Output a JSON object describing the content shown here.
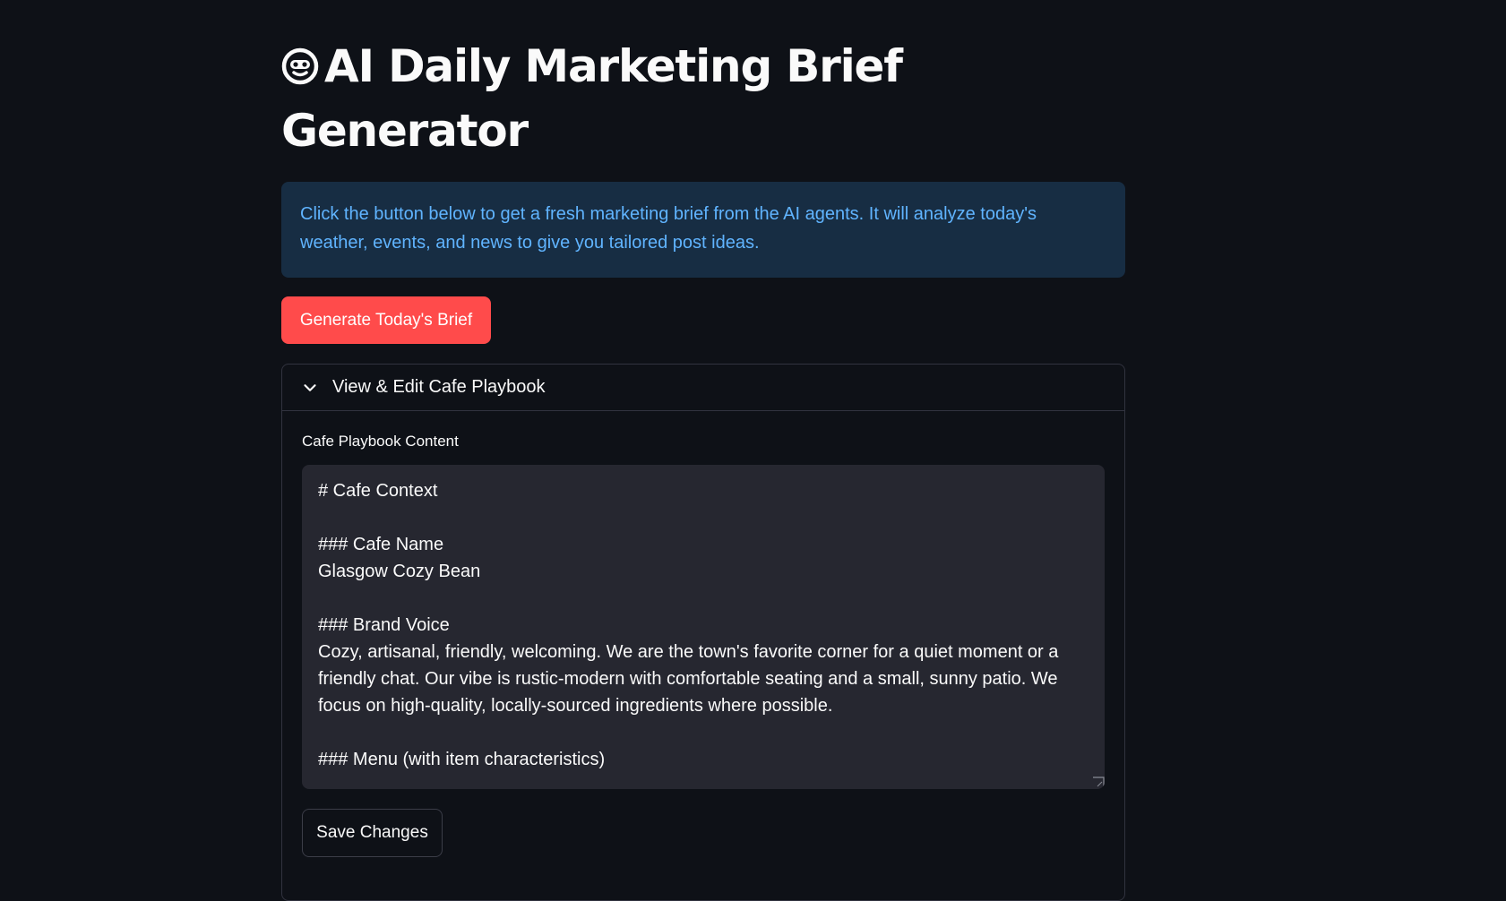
{
  "header": {
    "title": "AI Daily Marketing Brief Generator",
    "title_icon": "robot-face-icon"
  },
  "info": {
    "text": "Click the button below to get a fresh marketing brief from the AI agents. It will analyze today's weather, events, and news to give you tailored post ideas."
  },
  "actions": {
    "generate_label": "Generate Today's Brief"
  },
  "expander": {
    "label": "View & Edit Cafe Playbook",
    "icon": "chevron-down-icon",
    "field_label": "Cafe Playbook Content",
    "content": "# Cafe Context\n\n### Cafe Name\nGlasgow Cozy Bean\n\n### Brand Voice\nCozy, artisanal, friendly, welcoming. We are the town's favorite corner for a quiet moment or a friendly chat. Our vibe is rustic-modern with comfortable seating and a small, sunny patio. We focus on high-quality, locally-sourced ingredients where possible.\n\n### Menu (with item characteristics)",
    "save_label": "Save Changes"
  },
  "colors": {
    "background": "#0e1117",
    "info_bg": "#172d43",
    "info_text": "#60b4ff",
    "primary": "#ff4b4b",
    "input_bg": "#262730",
    "border": "#31333f"
  }
}
